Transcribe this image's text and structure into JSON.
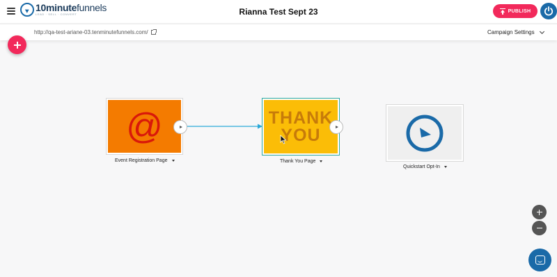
{
  "header": {
    "logo_text_bold": "10minute",
    "logo_text_regular": "funnels",
    "logo_tagline": "LEAD · SELL · CONVERT",
    "campaign_title": "Rianna Test Sept 23",
    "publish_label": "PUBLISH"
  },
  "urlbar": {
    "url": "http://qa-test-ariane-03.tenminutefunnels.com/",
    "settings_label": "Campaign Settings"
  },
  "canvas": {
    "nodes": [
      {
        "label": "Event Registration Page",
        "thumbnail": "at-sign",
        "color": "#f47b00",
        "glyph": "@"
      },
      {
        "label": "Thank You Page",
        "thumbnail": "thank-you",
        "color": "#fbbd07",
        "text_line1": "THANK",
        "text_line2": "YOU"
      },
      {
        "label": "Quickstart Opt-In",
        "thumbnail": "clock-icon",
        "color": "#efefef"
      }
    ],
    "connection": {
      "from": "Event Registration Page",
      "to": "Thank You Page",
      "color": "#2aa8d8"
    }
  },
  "colors": {
    "accent": "#f2295b",
    "brand_blue": "#1a6aa8"
  },
  "icons": [
    "menu-icon",
    "plus-icon",
    "upload-icon",
    "power-icon",
    "external-link-icon",
    "chevron-down-icon",
    "zoom-in-icon",
    "zoom-out-icon",
    "chat-icon"
  ]
}
